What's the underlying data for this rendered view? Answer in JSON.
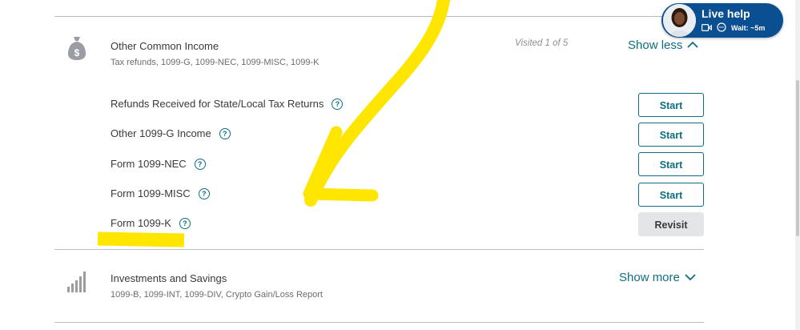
{
  "other_income": {
    "title": "Other Common Income",
    "subtitle": "Tax refunds, 1099-G, 1099-NEC, 1099-MISC, 1099-K",
    "visited": "Visited 1 of 5",
    "toggle_label": "Show less",
    "toggle_icon": "chevron-up-icon",
    "section_icon": "money-bag-icon",
    "items": [
      {
        "label": "Refunds Received for State/Local Tax Returns",
        "button": "Start"
      },
      {
        "label": "Other 1099-G Income",
        "button": "Start"
      },
      {
        "label": "Form 1099-NEC",
        "button": "Start"
      },
      {
        "label": "Form 1099-MISC",
        "button": "Start"
      },
      {
        "label": "Form 1099-K",
        "button": "Revisit"
      }
    ],
    "help_glyph": "?"
  },
  "investments": {
    "title": "Investments and Savings",
    "subtitle": "1099-B, 1099-INT, 1099-DIV, Crypto Gain/Loss Report",
    "toggle_label": "Show more",
    "toggle_icon": "chevron-down-icon",
    "section_icon": "bar-chart-icon"
  },
  "live_help": {
    "title": "Live help",
    "wait": "Wait: ~5m",
    "icons": [
      "video-icon",
      "chat-icon"
    ]
  },
  "colors": {
    "teal": "#0d6e80",
    "live_help_bg": "#0a4f92",
    "annotation_yellow": "#ffe600",
    "revisit_bg": "#e4e5e7"
  }
}
